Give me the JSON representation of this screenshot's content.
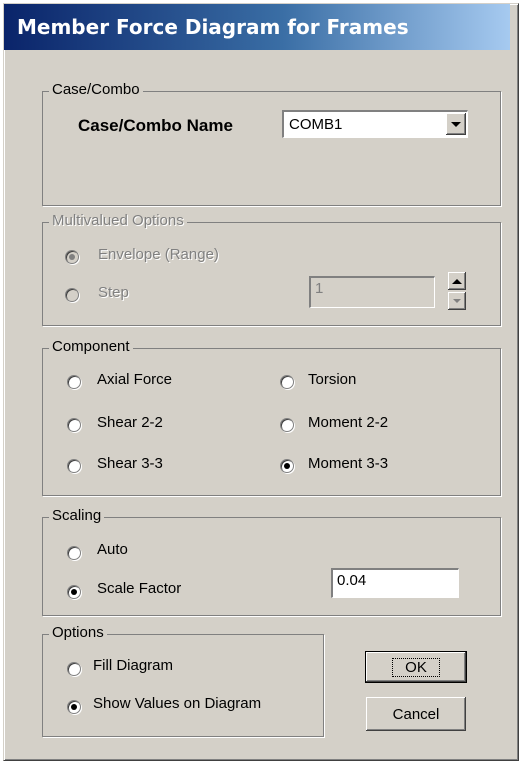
{
  "window": {
    "title": "Member Force Diagram for Frames"
  },
  "case_combo": {
    "legend": "Case/Combo",
    "name_label": "Case/Combo Name",
    "selected": "COMB1"
  },
  "multivalued": {
    "legend": "Multivalued Options",
    "envelope_label": "Envelope (Range)",
    "step_label": "Step",
    "step_value": "1",
    "selected": "envelope"
  },
  "component": {
    "legend": "Component",
    "options": [
      "Axial Force",
      "Torsion",
      "Shear 2-2",
      "Moment 2-2",
      "Shear 3-3",
      "Moment 3-3"
    ],
    "selected": "Moment 3-3"
  },
  "scaling": {
    "legend": "Scaling",
    "auto_label": "Auto",
    "scale_factor_label": "Scale Factor",
    "scale_factor_value": "0.04",
    "selected": "scale_factor"
  },
  "options": {
    "legend": "Options",
    "fill_label": "Fill Diagram",
    "show_values_label": "Show Values on Diagram",
    "selected": "show_values"
  },
  "buttons": {
    "ok": "OK",
    "cancel": "Cancel"
  }
}
